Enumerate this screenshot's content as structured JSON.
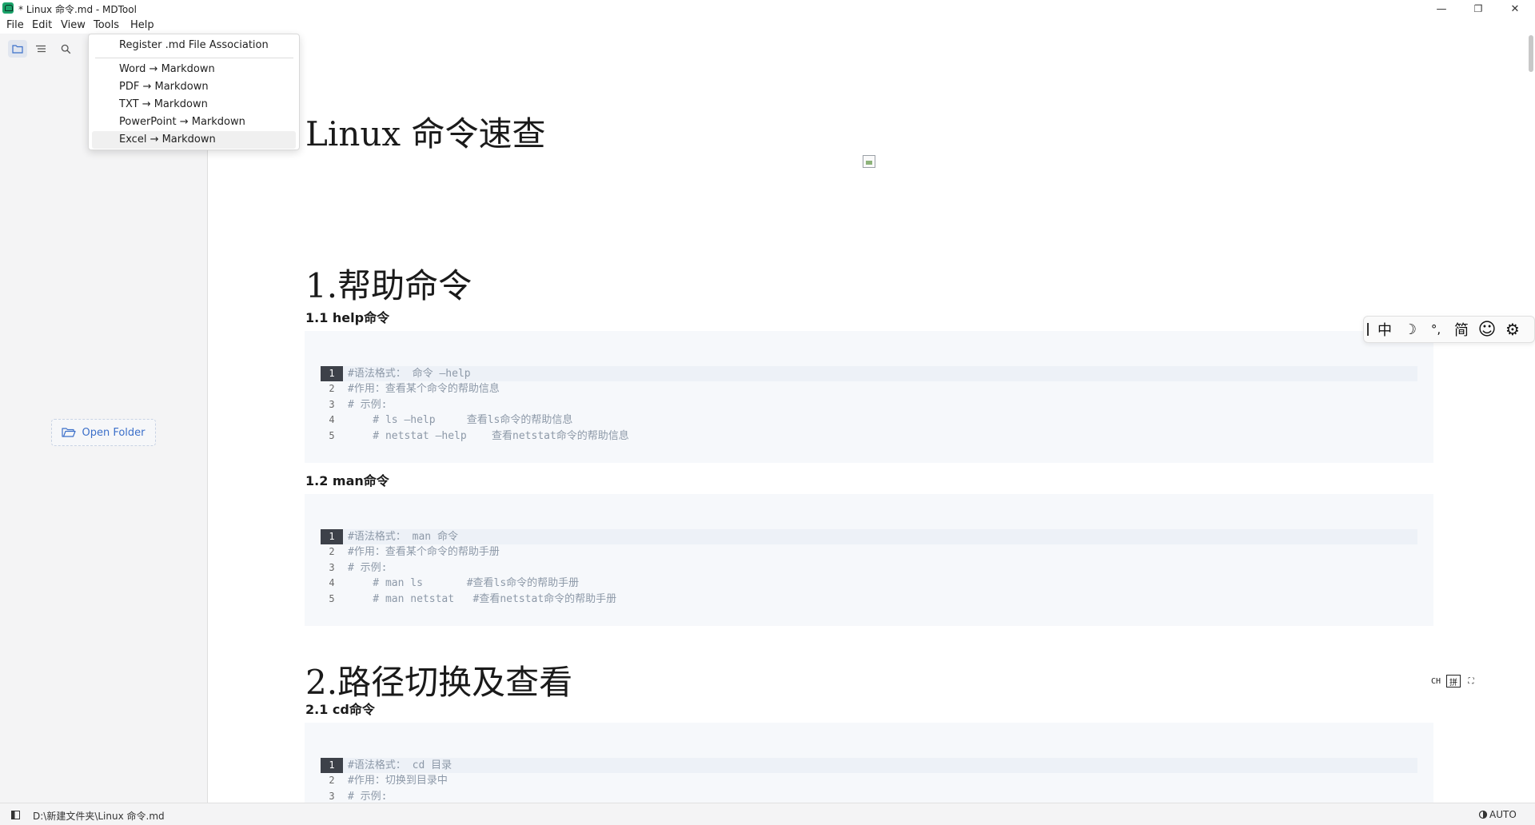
{
  "window": {
    "title": "* Linux 命令.md - MDTool",
    "controls": {
      "minimize": "—",
      "maximize": "❐",
      "close": "✕"
    }
  },
  "menubar": {
    "items": [
      "File",
      "Edit",
      "View",
      "Tools",
      "Help"
    ]
  },
  "tools_menu": {
    "register": "Register .md File Association",
    "items": [
      "Word → Markdown",
      "PDF → Markdown",
      "TXT → Markdown",
      "PowerPoint → Markdown",
      "Excel → Markdown"
    ],
    "hovered_index": 4
  },
  "sidebar": {
    "tools": [
      "folder-icon",
      "outline-icon",
      "search-icon"
    ],
    "active_tool": "folder-icon",
    "open_folder_label": "Open Folder"
  },
  "document": {
    "title": "Linux 命令速查",
    "sections": [
      {
        "heading": "1.帮助命令",
        "subsections": [
          {
            "heading": "1.1 help命令",
            "code": [
              "#语法格式： 命令 —help",
              "#作用：查看某个命令的帮助信息",
              "# 示例:",
              "    # ls —help     查看ls命令的帮助信息",
              "    # netstat —help    查看netstat命令的帮助信息"
            ]
          },
          {
            "heading": "1.2 man命令",
            "code": [
              "#语法格式： man 命令",
              "#作用：查看某个命令的帮助手册",
              "# 示例:",
              "    # man ls       #查看ls命令的帮助手册",
              "    # man netstat   #查看netstat命令的帮助手册"
            ]
          }
        ]
      },
      {
        "heading": "2.路径切换及查看",
        "subsections": [
          {
            "heading": "2.1 cd命令",
            "code": [
              "#语法格式： cd 目录",
              "#作用：切换到目录中",
              "# 示例:"
            ]
          }
        ]
      }
    ]
  },
  "ime_toolbar": {
    "mode": "中",
    "moon": "☽",
    "punct": "°,",
    "simplified": "简",
    "emoji": "☺",
    "settings": "⚙"
  },
  "ime_status": {
    "lang": "CH",
    "pinyin": "拼",
    "expand": "⛶"
  },
  "statusbar": {
    "path": "D:\\新建文件夹\\Linux 命令.md",
    "mode": "AUTO"
  }
}
